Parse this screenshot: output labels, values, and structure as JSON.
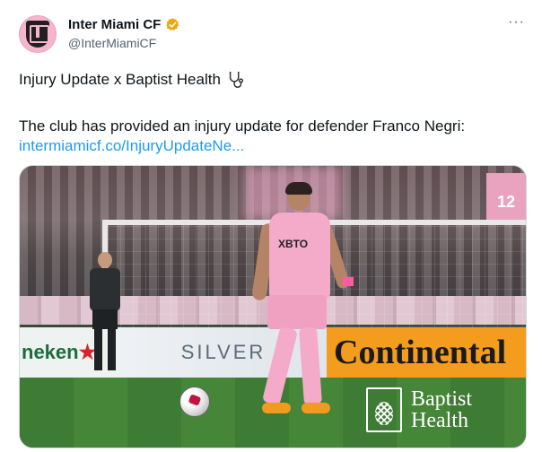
{
  "account": {
    "display_name": "Inter Miami CF",
    "handle": "@InterMiamiCF",
    "verified_icon": "verified-badge-icon",
    "avatar_icon": "inter-miami-crest-icon"
  },
  "menu": {
    "more_label": "···"
  },
  "tweet": {
    "line1": "Injury Update x Baptist Health",
    "line1_emoji_icon": "stethoscope-icon",
    "line2": "The club has provided an injury update for defender Franco Negri:",
    "link_text": "intermiamicf.co/InjuryUpdateNe..."
  },
  "media": {
    "scoreboard_text": "12",
    "boards": {
      "heineken": "neken",
      "silver": "SILVER",
      "continental": "Continental"
    },
    "player_sponsor": "XBTO",
    "sponsor_logo_line1": "Baptist",
    "sponsor_logo_line2": "Health"
  },
  "colors": {
    "link": "#1d9bf0",
    "secondary_text": "#536471",
    "verified": "#f4b400",
    "pink": "#f4aac9"
  }
}
